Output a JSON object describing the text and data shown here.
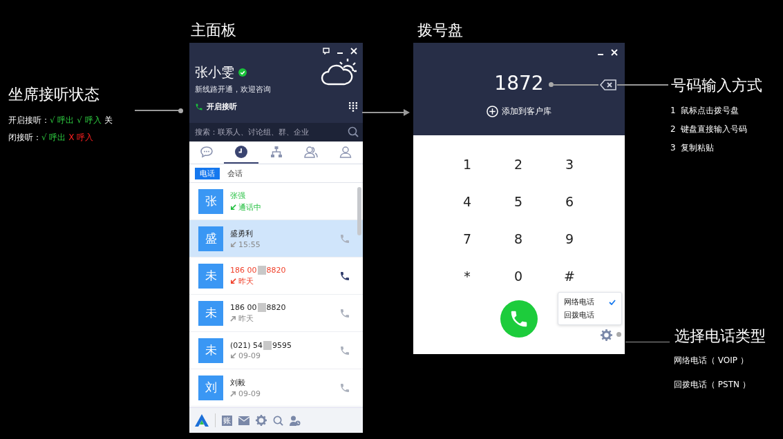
{
  "left_note": {
    "title": "坐席接听状态",
    "lines": [
      [
        {
          "text": "开启接听：",
          "kind": "plain"
        },
        {
          "text": "√ 呼出 √ 呼入",
          "kind": "ok"
        },
        {
          "text": " 关",
          "kind": "plain"
        }
      ],
      [
        {
          "text": "闭接听：",
          "kind": "plain"
        },
        {
          "text": "√ 呼出",
          "kind": "ok"
        },
        {
          "text": " X 呼入",
          "kind": "bad"
        }
      ]
    ]
  },
  "main_panel": {
    "caption": "主面板",
    "user": {
      "name": "张小雯",
      "online": true,
      "motto": "新线路开通，欢迎咨询"
    },
    "answer_toggle": "开启接听",
    "search": {
      "placeholder": "搜索：联系人、讨论组、群、企业"
    },
    "tabs": [
      {
        "kind": "chat",
        "selected": false
      },
      {
        "kind": "history",
        "selected": true
      },
      {
        "kind": "org",
        "selected": false
      },
      {
        "kind": "group",
        "selected": false
      },
      {
        "kind": "contact",
        "selected": false
      }
    ],
    "subtabs": [
      {
        "label": "电话",
        "selected": true
      },
      {
        "label": "会话",
        "selected": false
      }
    ],
    "calls": [
      {
        "avatar": "张",
        "name": [
          "张强"
        ],
        "in_call": true,
        "missed": false,
        "outgoing": false,
        "info": "通话中",
        "selected": false
      },
      {
        "avatar": "盛",
        "name": [
          "盛勇利"
        ],
        "in_call": false,
        "missed": false,
        "outgoing": false,
        "info": "15:55",
        "selected": true
      },
      {
        "avatar": "未",
        "name": [
          "186 00",
          "8820"
        ],
        "in_call": false,
        "missed": true,
        "outgoing": false,
        "info": "昨天",
        "selected": false
      },
      {
        "avatar": "未",
        "name": [
          "186 00",
          "8820"
        ],
        "in_call": false,
        "missed": false,
        "outgoing": true,
        "info": "昨天",
        "selected": false
      },
      {
        "avatar": "未",
        "name": [
          "(021) 54",
          "9595"
        ],
        "in_call": false,
        "missed": false,
        "outgoing": false,
        "info": "09-09",
        "selected": false
      },
      {
        "avatar": "刘",
        "name": [
          "刘毅"
        ],
        "in_call": false,
        "missed": false,
        "outgoing": true,
        "info": "09-09",
        "selected": false
      }
    ],
    "bottom_bar": {
      "account_badge": "账"
    }
  },
  "dialer": {
    "caption": "拨号盘",
    "number": "1872",
    "add_contact": "添加到客户库",
    "keys": [
      "1",
      "2",
      "3",
      "4",
      "5",
      "6",
      "7",
      "8",
      "9",
      "*",
      "0",
      "#"
    ],
    "call_types": [
      {
        "label": "网络电话",
        "checked": true
      },
      {
        "label": "回拨电话",
        "checked": false
      }
    ]
  },
  "input_note": {
    "title": "号码输入方式",
    "items": [
      "1  鼠标点击拨号盘",
      "2  键盘直接输入号码",
      "3  复制粘贴"
    ]
  },
  "type_note": {
    "title": "选择电话类型",
    "items": [
      "网络电话（ VOIP ）",
      "回拨电话（ PSTN ）"
    ]
  }
}
